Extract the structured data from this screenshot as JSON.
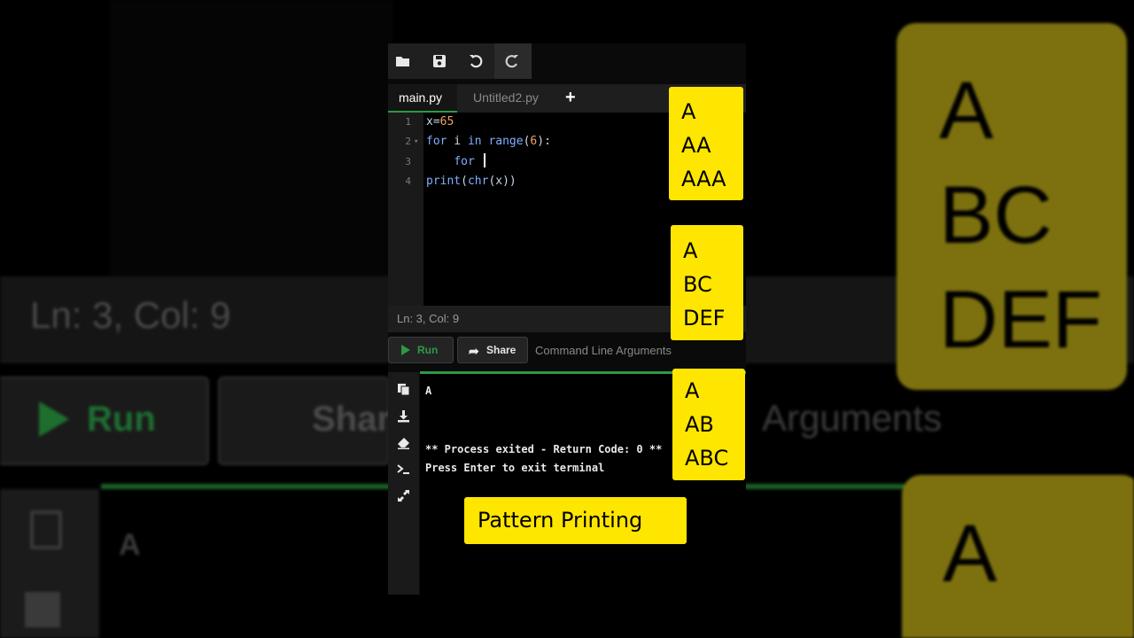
{
  "background": {
    "status": "Ln: 3,  Col: 9",
    "run_label": "Run",
    "share_label": "Share",
    "args_label": "Arguments",
    "terminal_first": "A",
    "card1_lines": [
      "A",
      "BC",
      "DEF"
    ],
    "card2_lines": [
      "A"
    ]
  },
  "toolbar": {
    "icons": [
      "folder-open-icon",
      "save-icon",
      "undo-icon",
      "redo-icon"
    ]
  },
  "tabs": {
    "active": "main.py",
    "second": "Untitled2.py",
    "add": "+"
  },
  "editor": {
    "lines": [
      {
        "n": "1",
        "code": "x=65"
      },
      {
        "n": "2",
        "code": "for i in range(6):"
      },
      {
        "n": "3",
        "code": "    for "
      },
      {
        "n": "4",
        "code": "print(chr(x))"
      }
    ]
  },
  "status": {
    "text": "Ln: 3,  Col: 9"
  },
  "actions": {
    "run_label": "Run",
    "share_label": "Share",
    "args_placeholder": "Command Line Arguments"
  },
  "terminal": {
    "lines": [
      "A",
      "** Process exited - Return Code: 0 **",
      "Press Enter to exit terminal"
    ]
  },
  "overlays": {
    "pattern1": [
      "A",
      "AA",
      "AAA"
    ],
    "pattern2": [
      "A",
      "BC",
      "DEF"
    ],
    "pattern3": [
      "A",
      "AB",
      "ABC"
    ],
    "caption": "Pattern Printing"
  },
  "colors": {
    "accent_green": "#2e9a44",
    "highlight_yellow": "#ffe600",
    "editor_bg": "#000000",
    "panel_bg": "#1e1e1e"
  }
}
